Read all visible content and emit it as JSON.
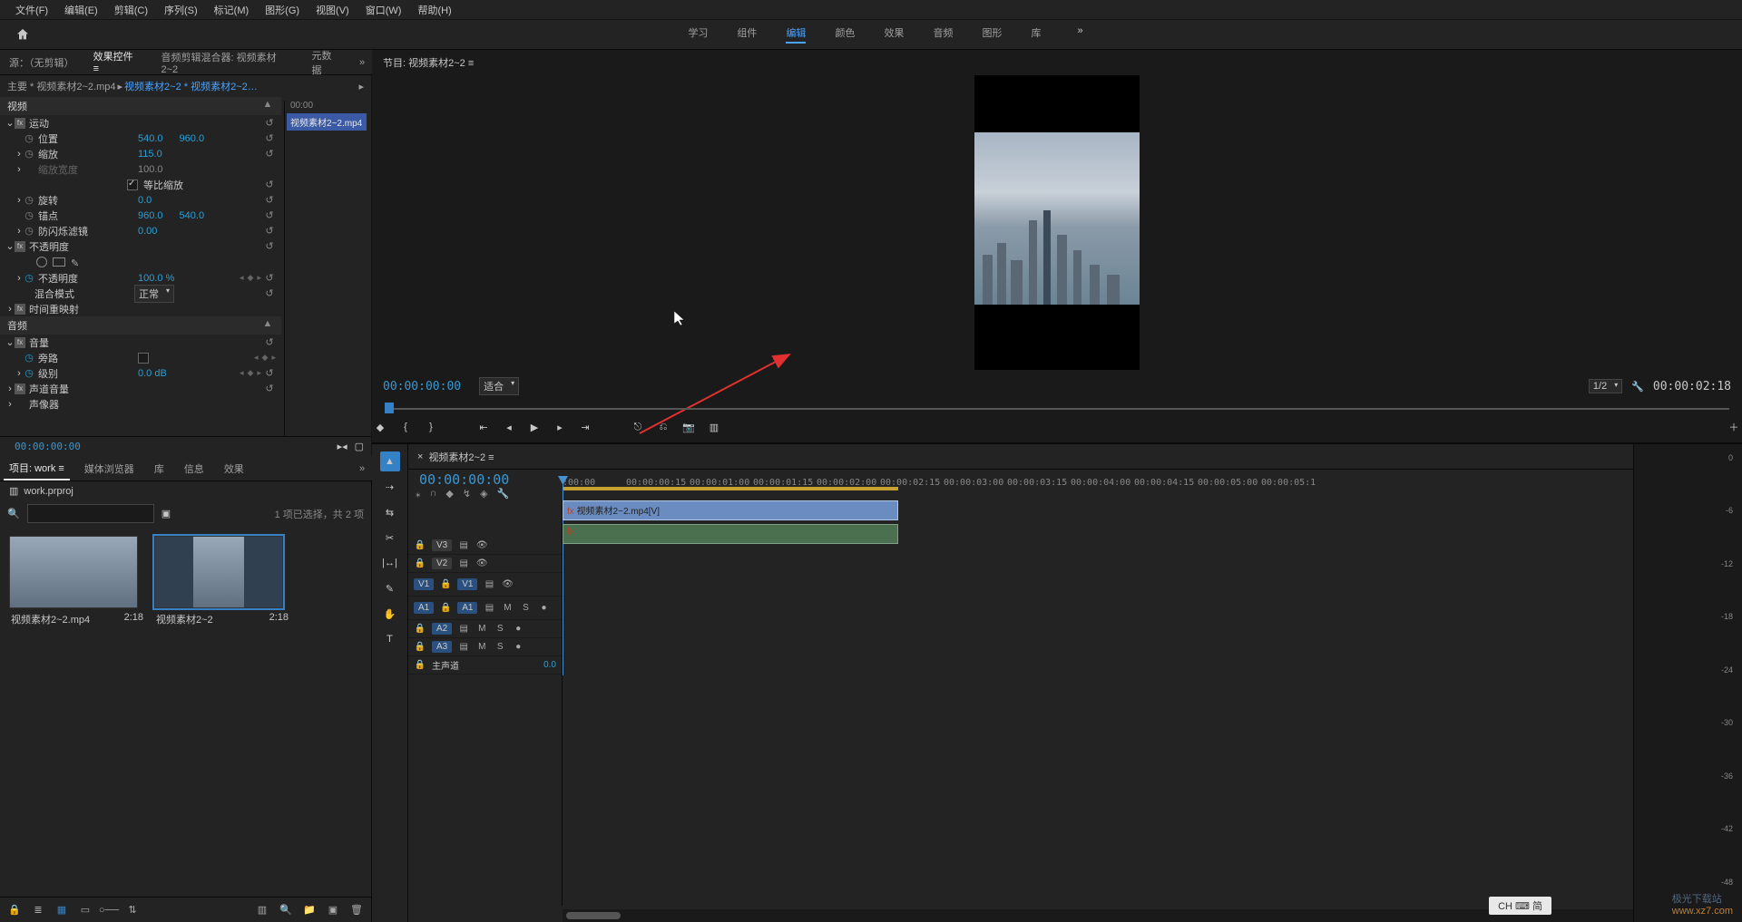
{
  "menubar": {
    "items": [
      "文件(F)",
      "编辑(E)",
      "剪辑(C)",
      "序列(S)",
      "标记(M)",
      "图形(G)",
      "视图(V)",
      "窗口(W)",
      "帮助(H)"
    ]
  },
  "workspace": {
    "tabs": [
      "学习",
      "组件",
      "编辑",
      "颜色",
      "效果",
      "音频",
      "图形",
      "库"
    ],
    "active_index": 2
  },
  "source_tabs": {
    "items": [
      "源：（无剪辑）",
      "效果控件 ≡",
      "音频剪辑混合器: 视频素材2~2",
      "元数据"
    ],
    "active_index": 1
  },
  "effect": {
    "breadcrumb_main": "主要 * 视频素材2~2.mp4",
    "breadcrumb_seq": "视频素材2~2 * 视频素材2~2…",
    "mini_tl_time": "00:00",
    "mini_tl_clip": "视频素材2~2.mp4",
    "video_head": "视频",
    "motion": "运动",
    "position": "位置",
    "position_x": "540.0",
    "position_y": "960.0",
    "scale": "缩放",
    "scale_val": "115.0",
    "scale_w": "缩放宽度",
    "scale_w_val": "100.0",
    "uniform": "等比缩放",
    "rotation": "旋转",
    "rotation_val": "0.0",
    "anchor": "锚点",
    "anchor_x": "960.0",
    "anchor_y": "540.0",
    "flicker": "防闪烁滤镜",
    "flicker_val": "0.00",
    "opacity_head": "不透明度",
    "opacity": "不透明度",
    "opacity_val": "100.0 %",
    "blend": "混合模式",
    "blend_val": "正常",
    "time_remap": "时间重映射",
    "audio_head": "音频",
    "volume_head": "音量",
    "bypass": "旁路",
    "level": "级别",
    "level_val": "0.0 dB",
    "channel_vol": "声道音量",
    "panner": "声像器",
    "tc_small": "00:00:00:00"
  },
  "program": {
    "tab_label": "节目: 视频素材2~2 ≡",
    "tc_left": "00:00:00:00",
    "fit_label": "适合",
    "resolution": "1/2",
    "tc_right": "00:00:02:18"
  },
  "project_tabs": {
    "items": [
      "项目: work ≡",
      "媒体浏览器",
      "库",
      "信息",
      "效果"
    ],
    "active_index": 0
  },
  "project": {
    "file": "work.prproj",
    "search_placeholder": "",
    "status": "1 项已选择，共 2 项",
    "thumbs": [
      {
        "name": "视频素材2~2.mp4",
        "duration": "2:18"
      },
      {
        "name": "视频素材2~2",
        "duration": "2:18"
      }
    ]
  },
  "timeline": {
    "seq_tab": "视频素材2~2 ≡",
    "tc": "00:00:00:00",
    "ruler": [
      ":00:00",
      "00:00:00:15",
      "00:00:01:00",
      "00:00:01:15",
      "00:00:02:00",
      "00:00:02:15",
      "00:00:03:00",
      "00:00:03:15",
      "00:00:04:00",
      "00:00:04:15",
      "00:00:05:00",
      "00:00:05:1"
    ],
    "v3": "V3",
    "v2": "V2",
    "v1": "V1",
    "a1": "A1",
    "a2": "A2",
    "a3": "A3",
    "master": "主声道",
    "master_val": "0.0",
    "clip_v": "视频素材2~2.mp4[V]",
    "mute": "M",
    "solo": "S"
  },
  "meter_ticks": [
    "0",
    "-6",
    "-12",
    "-18",
    "-24",
    "-30",
    "-36",
    "-42",
    "-48"
  ],
  "ime": "CH ⌨ 简",
  "watermark_top": "极光下载站",
  "watermark_url": "www.xz7.com"
}
